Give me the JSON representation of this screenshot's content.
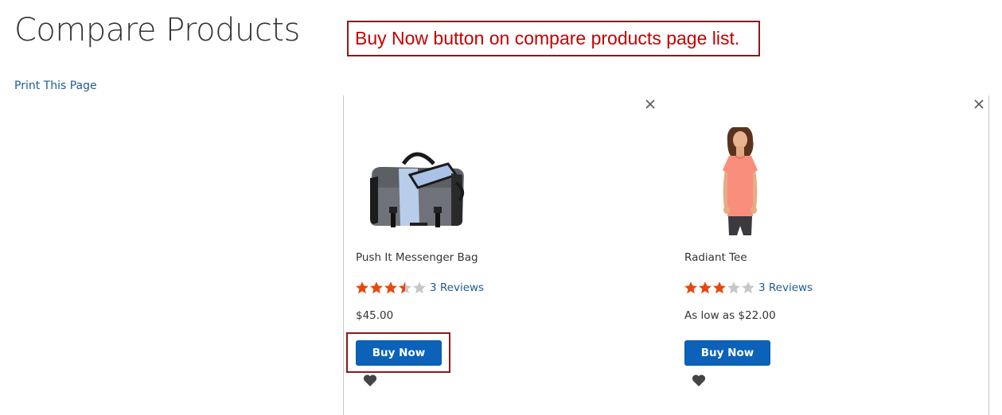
{
  "page": {
    "title": "Compare Products",
    "print_link": "Print This Page"
  },
  "annotation": {
    "text": "Buy Now button on compare products page list."
  },
  "colors": {
    "link": "#1f5d90",
    "button": "#0b62b8",
    "star_filled": "#e8470e",
    "star_empty": "#c7c7c7",
    "annotation": "#c40000"
  },
  "products": [
    {
      "name": "Push It Messenger Bag",
      "rating_fraction": 0.7,
      "reviews": "3 Reviews",
      "price": "$45.00",
      "buy_label": "Buy Now",
      "image": "messenger-bag"
    },
    {
      "name": "Radiant Tee",
      "rating_fraction": 0.6,
      "reviews": "3 Reviews",
      "price": "As low as $22.00",
      "buy_label": "Buy Now",
      "image": "coral-tee"
    }
  ]
}
